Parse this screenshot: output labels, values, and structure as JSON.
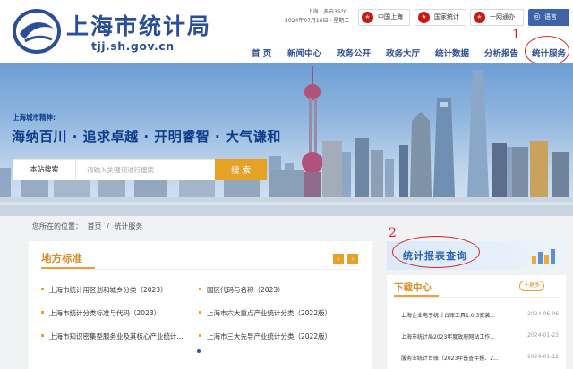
{
  "header": {
    "site_title": "上海市统计局",
    "site_domain": "tjj.sh.gov.cn",
    "weather": {
      "line1": "上海 · 多云35°C",
      "line2": "2024年07月16日 · 星期二"
    },
    "top_links": [
      {
        "label": "中国上海",
        "icon": "emblem-icon"
      },
      {
        "label": "国家统计",
        "icon": "emblem-icon"
      },
      {
        "label": "一网通办",
        "icon": "emblem-icon"
      },
      {
        "label": "语言",
        "icon": "globe-icon"
      }
    ],
    "nav": [
      "首 页",
      "新闻中心",
      "政务公开",
      "政务大厅",
      "统计数据",
      "分析报告",
      "统计服务"
    ]
  },
  "hero": {
    "tag": "上海城市精神:",
    "slogan": "海纳百川 · 追求卓越 · 开明睿智 · 大气谦和",
    "search": {
      "label": "本站搜索",
      "placeholder": "请输入关键词进行搜索",
      "button": "搜 索"
    }
  },
  "breadcrumb": {
    "prefix": "您所在的位置：",
    "items": [
      "首页",
      "/",
      "统计服务"
    ]
  },
  "standards": {
    "title": "地方标准",
    "prev": "‹",
    "next": "›",
    "items": [
      "上海市统计用区划和城乡分类（2023）",
      "园区代码与名称（2023）",
      "上海市统计分类标准与代码（2023）",
      "上海市六大重点产业统计分类（2022版）",
      "上海市知识密集型服务业及其核心产业统计...",
      "上海市三大先导产业统计分类（2022版）"
    ]
  },
  "report_banner": {
    "label": "统计报表查询"
  },
  "downloads": {
    "title": "下载中心",
    "more": "十更多",
    "items": [
      {
        "title": "上海企业电子统计台账工具1.0.3安装...",
        "date": "2024-06-06"
      },
      {
        "title": "上海市统计局2023年度政府网站工作...",
        "date": "2024-01-23"
      },
      {
        "title": "服务业统计台账（2023年普查年报、2...",
        "date": "2024-01-12"
      }
    ]
  },
  "annotations": [
    "1",
    "2"
  ]
}
